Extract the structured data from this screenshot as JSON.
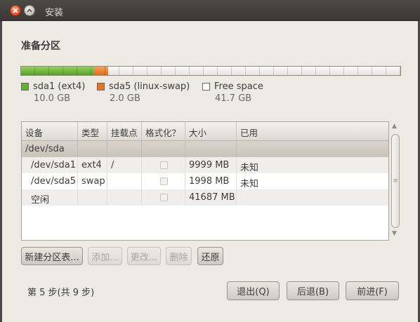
{
  "window": {
    "title": "安装"
  },
  "page": {
    "heading": "准备分区"
  },
  "partition_bar": {
    "segments": [
      {
        "name": "sda1",
        "fraction": 0.192,
        "color": "#6abb3a"
      },
      {
        "name": "sda5",
        "fraction": 0.038,
        "color": "#ec7c2a"
      },
      {
        "name": "free",
        "fraction": 0.77,
        "color": "#f2f1ef"
      }
    ]
  },
  "legend": [
    {
      "label": "sda1 (ext4)",
      "size": "10.0 GB",
      "color": "#5fb22f"
    },
    {
      "label": "sda5 (linux-swap)",
      "size": "2.0 GB",
      "color": "#e8741f"
    },
    {
      "label": "Free space",
      "size": "41.7 GB",
      "color": "#ffffff"
    }
  ],
  "table": {
    "headers": [
      "设备",
      "类型",
      "挂载点",
      "格式化？",
      "大小",
      "已用"
    ],
    "group_row": {
      "device": "/dev/sda"
    },
    "rows": [
      {
        "device": "/dev/sda1",
        "type": "ext4",
        "mount": "/",
        "format": false,
        "size": "9999 MB",
        "used": "未知"
      },
      {
        "device": "/dev/sda5",
        "type": "swap",
        "mount": "",
        "format": false,
        "size": "1998 MB",
        "used": "未知"
      },
      {
        "device": "空闲",
        "type": "",
        "mount": "",
        "format": false,
        "size": "41687 MB",
        "used": ""
      }
    ]
  },
  "actions": {
    "new_table": "新建分区表...",
    "add": "添加...",
    "change": "更改...",
    "delete": "删除",
    "revert": "还原"
  },
  "footer": {
    "step": "第 5 步(共 9 步)",
    "quit": "退出(Q)",
    "back": "后退(B)",
    "forward": "前进(F)"
  }
}
